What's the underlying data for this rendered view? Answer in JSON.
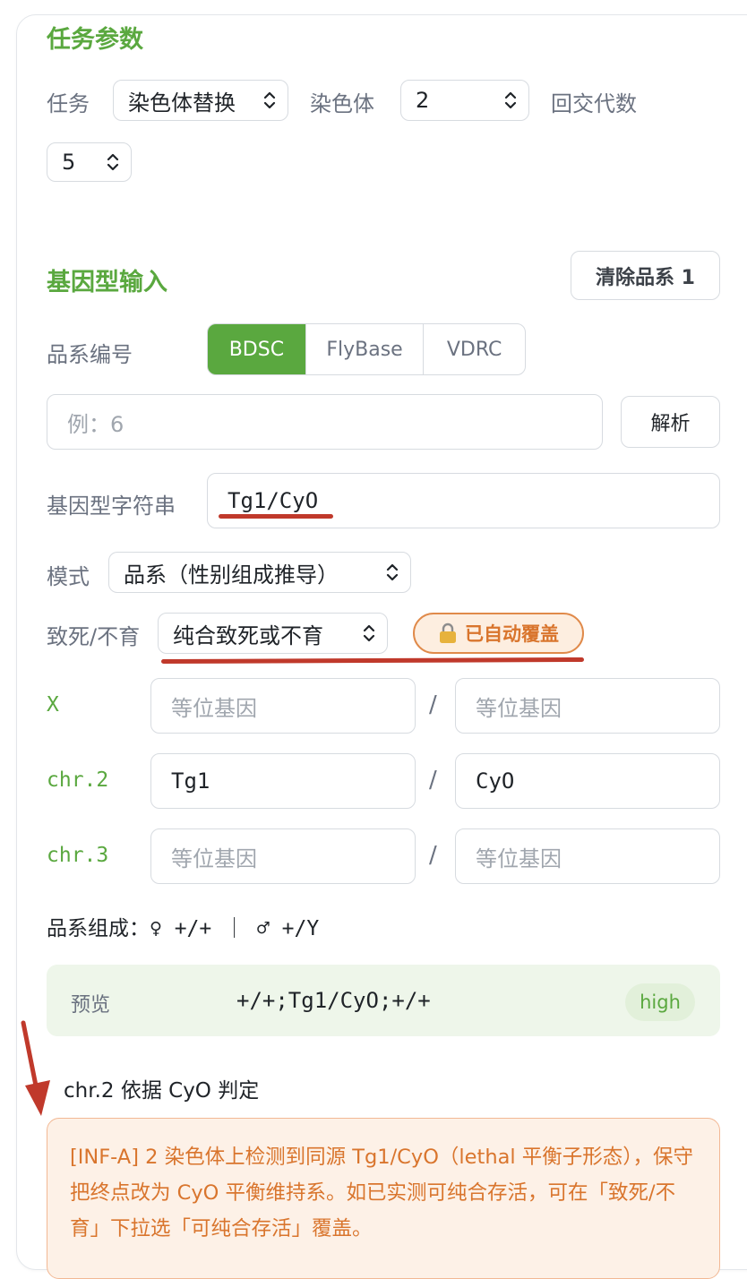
{
  "task_params": {
    "title": "任务参数",
    "task_label": "任务",
    "task_value": "染色体替换",
    "chromosome_label": "染色体",
    "chromosome_value": "2",
    "backcross_label": "回交代数",
    "backcross_value": "5"
  },
  "genotype_input": {
    "title": "基因型输入",
    "clear_button": "清除品系 1",
    "stock_id_label": "品系编号",
    "sources": [
      "BDSC",
      "FlyBase",
      "VDRC"
    ],
    "active_source": "BDSC",
    "stock_placeholder": "例：6",
    "parse_button": "解析",
    "genotype_string_label": "基因型字符串",
    "genotype_string_value": "Tg1/CyO",
    "mode_label": "模式",
    "mode_value": "品系（性别组成推导）",
    "lethal_label": "致死/不育",
    "lethal_value": "纯合致死或不育",
    "auto_override_badge": "已自动覆盖",
    "allele_placeholder": "等位基因",
    "rows": [
      {
        "label": "X",
        "left": "",
        "right": ""
      },
      {
        "label": "chr.2",
        "left": "Tg1",
        "right": "CyO"
      },
      {
        "label": "chr.3",
        "left": "",
        "right": ""
      }
    ],
    "separator": "/",
    "composition_label": "品系组成：",
    "composition_value": "♀ +/+ ｜ ♂ +/Y"
  },
  "preview": {
    "label": "预览",
    "value": "+/+;Tg1/CyO;+/+",
    "confidence": "high"
  },
  "inference": {
    "title": "chr.2 依据 CyO 判定",
    "message": "[INF-A] 2 染色体上检测到同源 Tg1/CyO（lethal 平衡子形态），保守把终点改为 CyO 平衡维持系。如已实测可纯合存活，可在「致死/不育」下拉选「可纯合存活」覆盖。"
  },
  "colors": {
    "accent_green": "#5aa83f",
    "annotation_red": "#c0392b",
    "warning_orange": "#d9752d",
    "warning_bg": "#fdf1e7"
  }
}
